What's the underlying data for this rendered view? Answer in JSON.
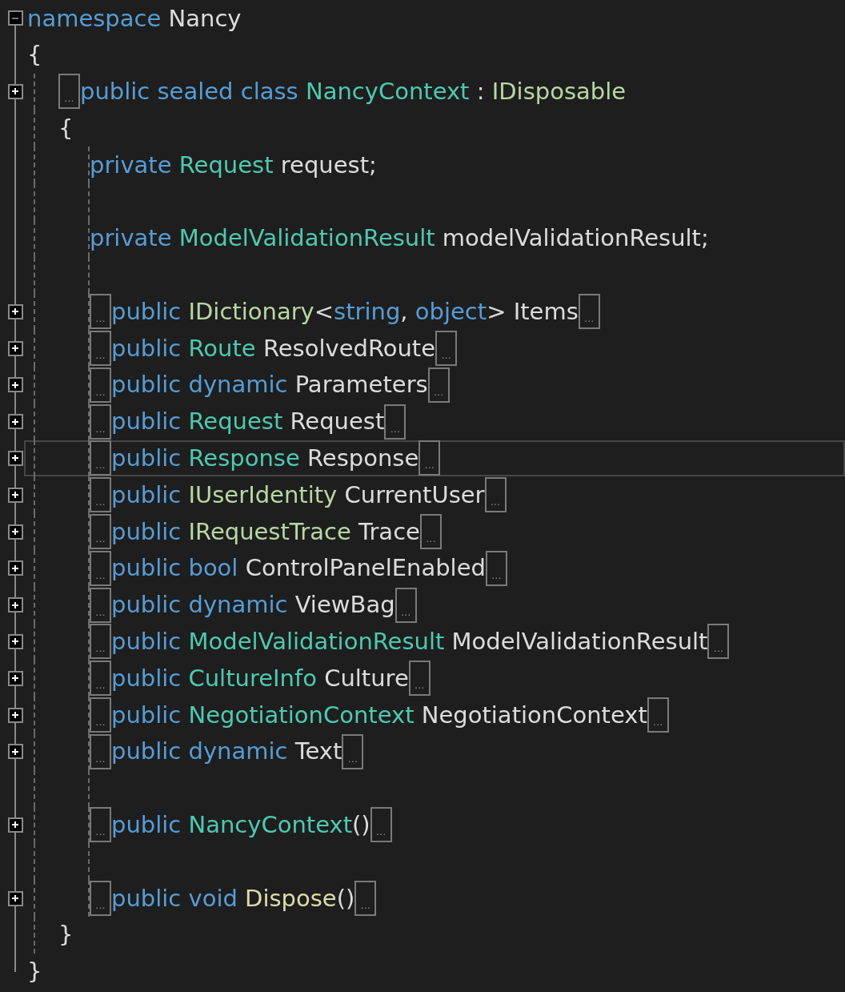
{
  "editor": {
    "lines": [
      {
        "kind": "code",
        "expanded": true,
        "current": false,
        "tokens": [
          {
            "text": "namespace ",
            "kind": "kw"
          },
          {
            "text": "Nancy",
            "kind": "id"
          }
        ]
      },
      {
        "kind": "code",
        "current": false,
        "tokens": [
          {
            "text": "{",
            "kind": "id"
          }
        ],
        "children": [
          {
            "kind": "code",
            "expanded": false,
            "current": false,
            "prefix": "...",
            "tokens": [
              {
                "text": "public sealed class ",
                "kind": "kw"
              },
              {
                "text": "NancyContext",
                "kind": "type"
              },
              {
                "text": " : ",
                "kind": "id"
              },
              {
                "text": "IDisposable",
                "kind": "iface"
              }
            ]
          },
          {
            "kind": "code",
            "current": false,
            "tokens": [
              {
                "text": "{",
                "kind": "id"
              }
            ],
            "children": [
              {
                "kind": "code",
                "current": false,
                "tokens": [
                  {
                    "text": "private ",
                    "kind": "kw"
                  },
                  {
                    "text": "Request",
                    "kind": "type"
                  },
                  {
                    "text": " request;",
                    "kind": "id"
                  }
                ]
              },
              {
                "kind": "blank"
              },
              {
                "kind": "code",
                "current": false,
                "tokens": [
                  {
                    "text": "private ",
                    "kind": "kw"
                  },
                  {
                    "text": "ModelValidationResult",
                    "kind": "type"
                  },
                  {
                    "text": " modelValidationResult;",
                    "kind": "id"
                  }
                ]
              },
              {
                "kind": "blank"
              },
              {
                "kind": "code",
                "expanded": false,
                "current": false,
                "prefix": "...",
                "suffix": "...",
                "tokens": [
                  {
                    "text": "public ",
                    "kind": "kw"
                  },
                  {
                    "text": "IDictionary",
                    "kind": "iface"
                  },
                  {
                    "text": "<",
                    "kind": "id"
                  },
                  {
                    "text": "string",
                    "kind": "kw"
                  },
                  {
                    "text": ", ",
                    "kind": "id"
                  },
                  {
                    "text": "object",
                    "kind": "kw"
                  },
                  {
                    "text": "> Items",
                    "kind": "id"
                  }
                ]
              },
              {
                "kind": "code",
                "expanded": false,
                "current": false,
                "prefix": "...",
                "suffix": "...",
                "tokens": [
                  {
                    "text": "public ",
                    "kind": "kw"
                  },
                  {
                    "text": "Route",
                    "kind": "type"
                  },
                  {
                    "text": " ResolvedRoute",
                    "kind": "id"
                  }
                ]
              },
              {
                "kind": "code",
                "expanded": false,
                "current": false,
                "prefix": "...",
                "suffix": "...",
                "tokens": [
                  {
                    "text": "public dynamic ",
                    "kind": "kw"
                  },
                  {
                    "text": "Parameters",
                    "kind": "id"
                  }
                ]
              },
              {
                "kind": "code",
                "expanded": false,
                "current": false,
                "prefix": "...",
                "suffix": "...",
                "tokens": [
                  {
                    "text": "public ",
                    "kind": "kw"
                  },
                  {
                    "text": "Request",
                    "kind": "type"
                  },
                  {
                    "text": " Request",
                    "kind": "id"
                  }
                ]
              },
              {
                "kind": "code",
                "expanded": false,
                "current": true,
                "prefix": "...",
                "suffix": "...",
                "tokens": [
                  {
                    "text": "public ",
                    "kind": "kw"
                  },
                  {
                    "text": "Response",
                    "kind": "type"
                  },
                  {
                    "text": " Response",
                    "kind": "id"
                  }
                ]
              },
              {
                "kind": "code",
                "expanded": false,
                "current": false,
                "prefix": "...",
                "suffix": "...",
                "tokens": [
                  {
                    "text": "public ",
                    "kind": "kw"
                  },
                  {
                    "text": "IUserIdentity",
                    "kind": "iface"
                  },
                  {
                    "text": " CurrentUser",
                    "kind": "id"
                  }
                ]
              },
              {
                "kind": "code",
                "expanded": false,
                "current": false,
                "prefix": "...",
                "suffix": "...",
                "tokens": [
                  {
                    "text": "public ",
                    "kind": "kw"
                  },
                  {
                    "text": "IRequestTrace",
                    "kind": "iface"
                  },
                  {
                    "text": " Trace",
                    "kind": "id"
                  }
                ]
              },
              {
                "kind": "code",
                "expanded": false,
                "current": false,
                "prefix": "...",
                "suffix": "...",
                "tokens": [
                  {
                    "text": "public bool ",
                    "kind": "kw"
                  },
                  {
                    "text": "ControlPanelEnabled",
                    "kind": "id"
                  }
                ]
              },
              {
                "kind": "code",
                "expanded": false,
                "current": false,
                "prefix": "...",
                "suffix": "...",
                "tokens": [
                  {
                    "text": "public dynamic ",
                    "kind": "kw"
                  },
                  {
                    "text": "ViewBag",
                    "kind": "id"
                  }
                ]
              },
              {
                "kind": "code",
                "expanded": false,
                "current": false,
                "prefix": "...",
                "suffix": "...",
                "tokens": [
                  {
                    "text": "public ",
                    "kind": "kw"
                  },
                  {
                    "text": "ModelValidationResult",
                    "kind": "type"
                  },
                  {
                    "text": " ModelValidationResult",
                    "kind": "id"
                  }
                ]
              },
              {
                "kind": "code",
                "expanded": false,
                "current": false,
                "prefix": "...",
                "suffix": "...",
                "tokens": [
                  {
                    "text": "public ",
                    "kind": "kw"
                  },
                  {
                    "text": "CultureInfo",
                    "kind": "type"
                  },
                  {
                    "text": " Culture",
                    "kind": "id"
                  }
                ]
              },
              {
                "kind": "code",
                "expanded": false,
                "current": false,
                "prefix": "...",
                "suffix": "...",
                "tokens": [
                  {
                    "text": "public ",
                    "kind": "kw"
                  },
                  {
                    "text": "NegotiationContext",
                    "kind": "type"
                  },
                  {
                    "text": " NegotiationContext",
                    "kind": "id"
                  }
                ]
              },
              {
                "kind": "code",
                "expanded": false,
                "current": false,
                "prefix": "...",
                "suffix": "...",
                "tokens": [
                  {
                    "text": "public dynamic ",
                    "kind": "kw"
                  },
                  {
                    "text": "Text",
                    "kind": "id"
                  }
                ]
              },
              {
                "kind": "blank"
              },
              {
                "kind": "code",
                "expanded": false,
                "current": false,
                "prefix": "...",
                "suffix": "...",
                "tokens": [
                  {
                    "text": "public ",
                    "kind": "kw"
                  },
                  {
                    "text": "NancyContext",
                    "kind": "type"
                  },
                  {
                    "text": "()",
                    "kind": "id"
                  }
                ]
              },
              {
                "kind": "blank"
              },
              {
                "kind": "code",
                "expanded": false,
                "current": false,
                "prefix": "...",
                "suffix": "...",
                "tokens": [
                  {
                    "text": "public void ",
                    "kind": "kw"
                  },
                  {
                    "text": "Dispose",
                    "kind": "method"
                  },
                  {
                    "text": "()",
                    "kind": "id"
                  }
                ]
              }
            ]
          },
          {
            "kind": "code",
            "current": false,
            "tokens": [
              {
                "text": "}",
                "kind": "id"
              }
            ]
          }
        ]
      },
      {
        "kind": "code",
        "current": false,
        "tokens": [
          {
            "text": "}",
            "kind": "id"
          }
        ]
      }
    ]
  }
}
